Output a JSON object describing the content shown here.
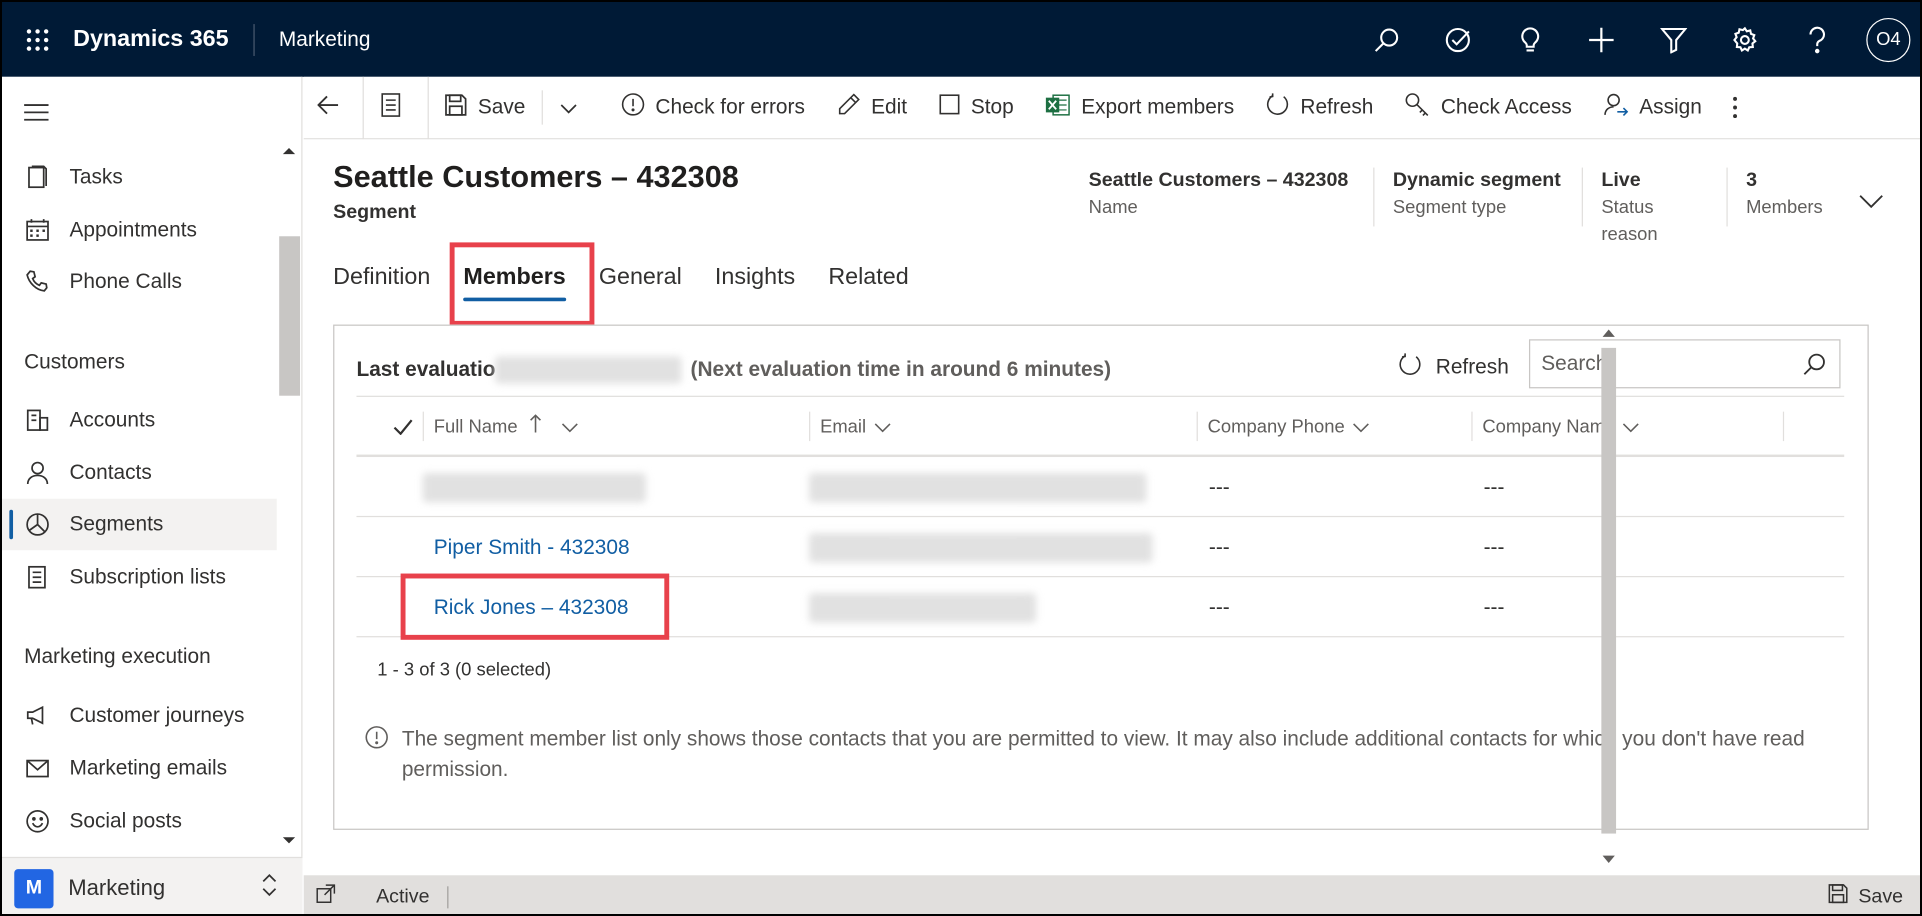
{
  "topbar": {
    "brand": "Dynamics 365",
    "app": "Marketing",
    "avatar": "O4",
    "icons": [
      "search-icon",
      "task-icon",
      "lightbulb-icon",
      "plus-icon",
      "filter-icon",
      "gear-icon",
      "help-icon"
    ]
  },
  "sidebar": {
    "items_top": [
      {
        "label": "Tasks",
        "icon": "tasks-icon"
      },
      {
        "label": "Appointments",
        "icon": "calendar-icon"
      },
      {
        "label": "Phone Calls",
        "icon": "phone-icon"
      }
    ],
    "group_customers": "Customers",
    "items_customers": [
      {
        "label": "Accounts",
        "icon": "accounts-icon"
      },
      {
        "label": "Contacts",
        "icon": "contact-icon"
      },
      {
        "label": "Segments",
        "icon": "segments-icon",
        "selected": true
      },
      {
        "label": "Subscription lists",
        "icon": "list-icon"
      }
    ],
    "group_execution": "Marketing execution",
    "items_execution": [
      {
        "label": "Customer journeys",
        "icon": "journey-icon"
      },
      {
        "label": "Marketing emails",
        "icon": "mail-icon"
      },
      {
        "label": "Social posts",
        "icon": "social-icon"
      }
    ],
    "area": {
      "badge": "M",
      "label": "Marketing"
    }
  },
  "commands": {
    "save": "Save",
    "check_errors": "Check for errors",
    "edit": "Edit",
    "stop": "Stop",
    "export": "Export members",
    "refresh": "Refresh",
    "check_access": "Check Access",
    "assign": "Assign"
  },
  "record": {
    "title": "Seattle Customers – 432308",
    "entity": "Segment",
    "header_fields": [
      {
        "value": "Seattle Customers – 432308",
        "label": "Name"
      },
      {
        "value": "Dynamic segment",
        "label": "Segment type"
      },
      {
        "value": "Live",
        "label": "Status reason"
      },
      {
        "value": "3",
        "label": "Members"
      }
    ]
  },
  "tabs": [
    "Definition",
    "Members",
    "General",
    "Insights",
    "Related"
  ],
  "active_tab": "Members",
  "members": {
    "last_eval_label": "Last evaluatio",
    "next_eval": "(Next evaluation time in around 6 minutes)",
    "refresh": "Refresh",
    "search_placeholder": "Search",
    "columns": [
      "Full Name",
      "Email",
      "Company Phone",
      "Company Name"
    ],
    "rows": [
      {
        "name": "",
        "email": "",
        "phone": "---",
        "company": "---"
      },
      {
        "name": "Piper Smith - 432308",
        "email": "",
        "phone": "---",
        "company": "---"
      },
      {
        "name": "Rick Jones – 432308",
        "email": "",
        "phone": "---",
        "company": "---"
      }
    ],
    "count": "1 - 3 of 3 (0 selected)",
    "notice": "The segment member list only shows those contacts that you are permitted to view. It may also include additional contacts for which you don't have read permission."
  },
  "status": {
    "state": "Active",
    "save": "Save"
  }
}
